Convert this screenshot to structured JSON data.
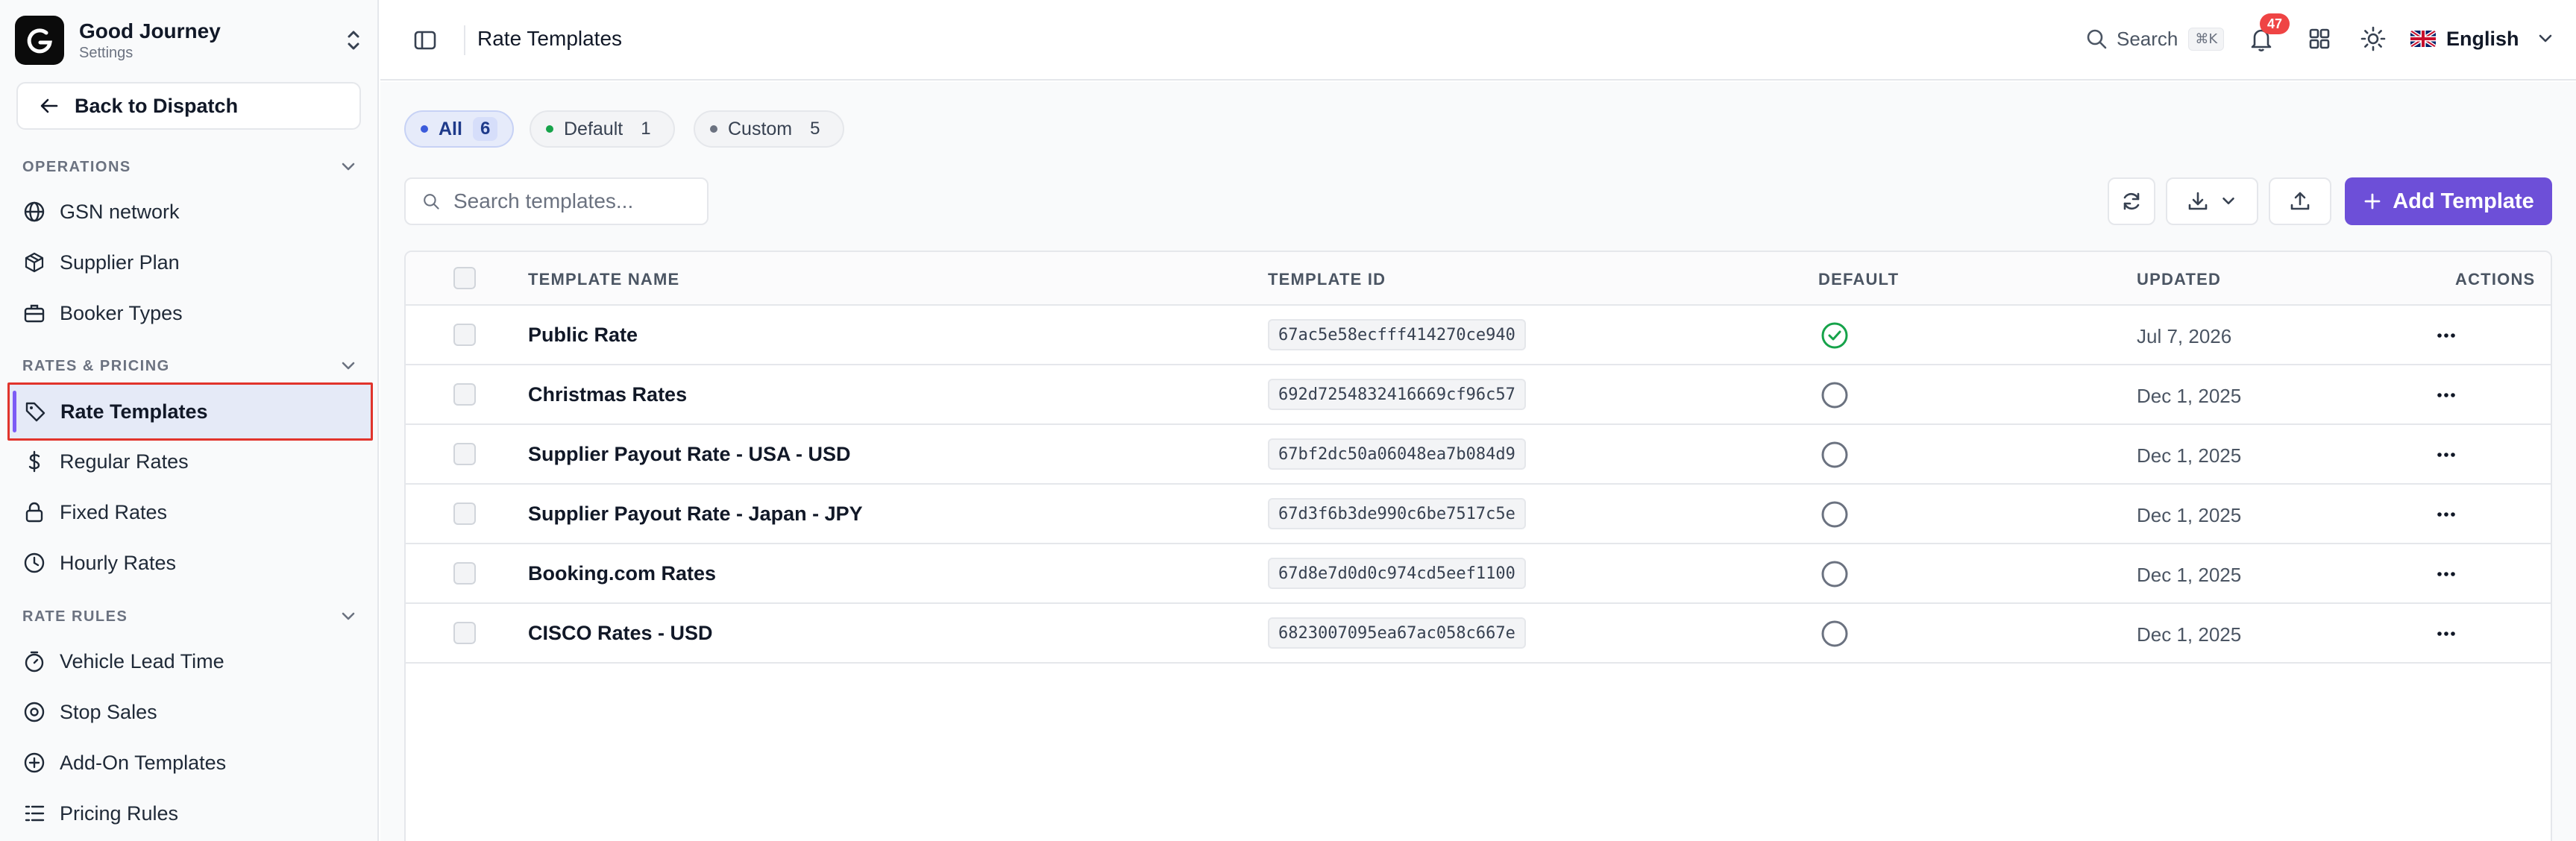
{
  "brand": {
    "name": "Good Journey",
    "subtitle": "Settings"
  },
  "sidebar": {
    "back_label": "Back to Dispatch",
    "sections": [
      {
        "title": "OPERATIONS",
        "items": [
          {
            "label": "GSN network",
            "icon": "globe-icon"
          },
          {
            "label": "Supplier Plan",
            "icon": "box-icon"
          },
          {
            "label": "Booker Types",
            "icon": "briefcase-icon"
          }
        ]
      },
      {
        "title": "RATES & PRICING",
        "items": [
          {
            "label": "Rate Templates",
            "icon": "tag-icon",
            "active": true
          },
          {
            "label": "Regular Rates",
            "icon": "dollar-icon"
          },
          {
            "label": "Fixed Rates",
            "icon": "lock-icon"
          },
          {
            "label": "Hourly Rates",
            "icon": "clock-icon"
          }
        ]
      },
      {
        "title": "RATE RULES",
        "items": [
          {
            "label": "Vehicle Lead Time",
            "icon": "timer-icon"
          },
          {
            "label": "Stop Sales",
            "icon": "stop-circle-icon"
          },
          {
            "label": "Add-On Templates",
            "icon": "plus-circle-icon"
          },
          {
            "label": "Pricing Rules",
            "icon": "list-icon"
          }
        ]
      }
    ]
  },
  "topbar": {
    "title": "Rate Templates",
    "search_label": "Search",
    "search_shortcut": "⌘K",
    "notification_count": "47",
    "language": "English"
  },
  "filters": [
    {
      "label": "All",
      "count": "6",
      "active": true,
      "dot": "#3b5bdb"
    },
    {
      "label": "Default",
      "count": "1",
      "active": false,
      "dot": "#16a34a"
    },
    {
      "label": "Custom",
      "count": "5",
      "active": false,
      "dot": "#6b7280"
    }
  ],
  "search": {
    "placeholder": "Search templates..."
  },
  "actions": {
    "add_label": "Add Template"
  },
  "table": {
    "columns": {
      "name": "TEMPLATE NAME",
      "id": "TEMPLATE ID",
      "default": "DEFAULT",
      "updated": "UPDATED",
      "actions": "ACTIONS"
    },
    "rows": [
      {
        "name": "Public Rate",
        "id": "67ac5e58ecfff414270ce940",
        "default": true,
        "updated": "Jul 7, 2026"
      },
      {
        "name": "Christmas Rates",
        "id": "692d7254832416669cf96c57",
        "default": false,
        "updated": "Dec 1, 2025"
      },
      {
        "name": "Supplier Payout Rate - USA - USD",
        "id": "67bf2dc50a06048ea7b084d9",
        "default": false,
        "updated": "Dec 1, 2025"
      },
      {
        "name": "Supplier Payout Rate - Japan - JPY",
        "id": "67d3f6b3de990c6be7517c5e",
        "default": false,
        "updated": "Dec 1, 2025"
      },
      {
        "name": "Booking.com Rates",
        "id": "67d8e7d0d0c974cd5eef1100",
        "default": false,
        "updated": "Dec 1, 2025"
      },
      {
        "name": "CISCO Rates - USD",
        "id": "6823007095ea67ac058c667e",
        "default": false,
        "updated": "Dec 1, 2025"
      }
    ]
  },
  "colors": {
    "accent": "#6d4fd8",
    "success": "#16a34a",
    "badge": "#ef4444",
    "highlight_border": "#e1342c"
  }
}
